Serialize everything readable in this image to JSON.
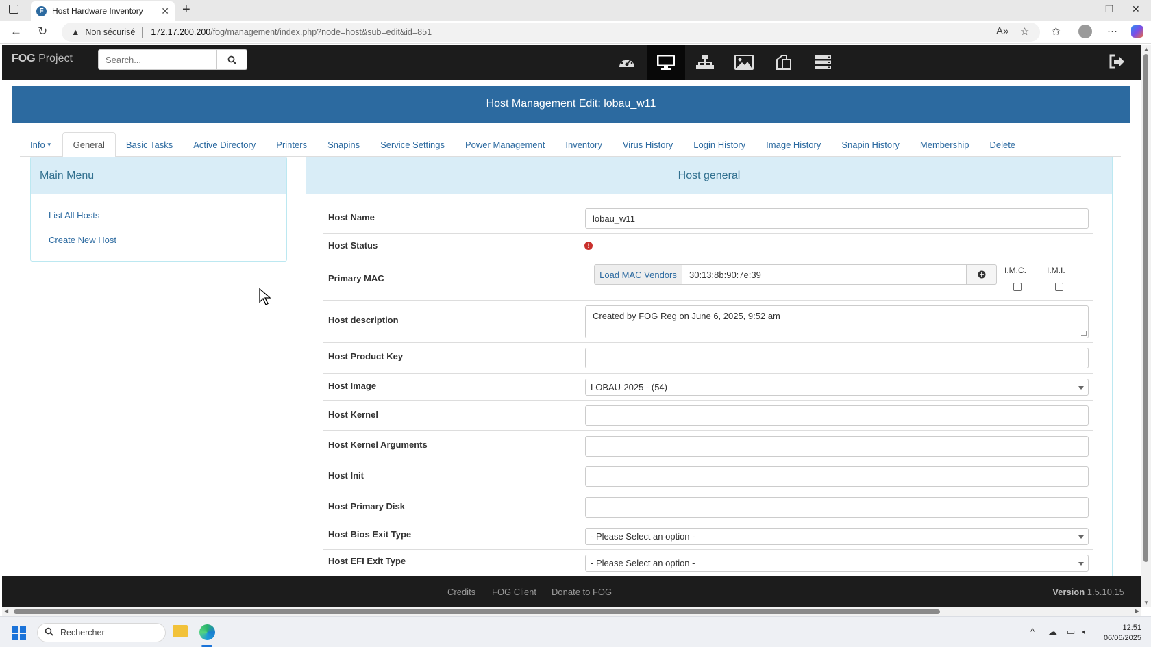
{
  "browser": {
    "tab_title": "Host Hardware Inventory",
    "tab_favicon": "F",
    "security_label": "Non sécurisé",
    "url_host": "172.17.200.200",
    "url_path": "/fog/management/index.php?node=host&sub=edit&id=851"
  },
  "header": {
    "brand_bold": "FOG",
    "brand_rest": " Project",
    "search_placeholder": "Search...",
    "nav_icons": [
      "dashboard-icon",
      "hosts-icon",
      "groups-icon",
      "images-icon",
      "snapins-icon",
      "storage-icon"
    ]
  },
  "page": {
    "title": "Host Management Edit: lobau_w11",
    "tabs": [
      "Info",
      "General",
      "Basic Tasks",
      "Active Directory",
      "Printers",
      "Snapins",
      "Service Settings",
      "Power Management",
      "Inventory",
      "Virus History",
      "Login History",
      "Image History",
      "Snapin History",
      "Membership",
      "Delete"
    ],
    "active_tab": "General"
  },
  "main_menu": {
    "title": "Main Menu",
    "items": [
      "List All Hosts",
      "Create New Host"
    ]
  },
  "host_general": {
    "title": "Host general",
    "labels": {
      "name": "Host Name",
      "status": "Host Status",
      "mac": "Primary MAC",
      "description": "Host description",
      "product_key": "Host Product Key",
      "image": "Host Image",
      "kernel": "Host Kernel",
      "kernel_args": "Host Kernel Arguments",
      "init": "Host Init",
      "primary_disk": "Host Primary Disk",
      "bios_exit": "Host Bios Exit Type",
      "efi_exit": "Host EFI Exit Type"
    },
    "values": {
      "name": "lobau_w11",
      "mac": "30:13:8b:90:7e:39",
      "description": "Created by FOG Reg on June 6, 2025, 9:52 am",
      "product_key": "",
      "image": "LOBAU-2025 - (54)",
      "kernel": "",
      "kernel_args": "",
      "init": "",
      "primary_disk": "",
      "bios_exit": "- Please Select an option -",
      "efi_exit": "- Please Select an option -"
    },
    "load_mac_vendors": "Load MAC Vendors",
    "imc_label": "I.M.C.",
    "imi_label": "I.M.I."
  },
  "footer": {
    "links": [
      "Credits",
      "FOG Client",
      "Donate to FOG"
    ],
    "version_label": "Version",
    "version": " 1.5.10.15"
  },
  "taskbar": {
    "search_placeholder": "Rechercher",
    "time": "12:51",
    "date": "06/06/2025"
  },
  "colors": {
    "accent": "#2c6aa0",
    "header_bg": "#1c1c1c",
    "panel_head": "#d9edf7",
    "status_error": "#c9302c"
  }
}
